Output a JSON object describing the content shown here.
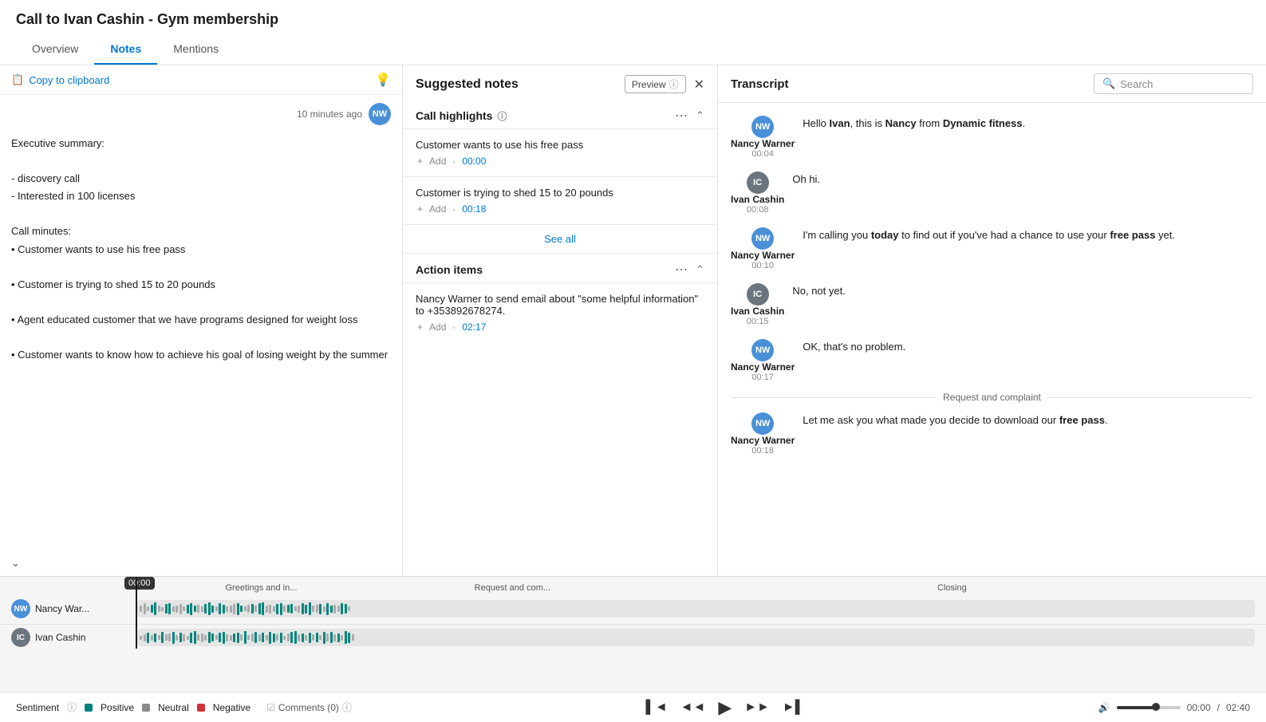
{
  "page": {
    "title": "Call to Ivan Cashin - Gym membership"
  },
  "tabs": [
    {
      "id": "overview",
      "label": "Overview",
      "active": false
    },
    {
      "id": "notes",
      "label": "Notes",
      "active": true
    },
    {
      "id": "mentions",
      "label": "Mentions",
      "active": false
    }
  ],
  "left_panel": {
    "copy_label": "Copy to clipboard",
    "timestamp": "10 minutes ago",
    "notes_content": [
      "Executive summary:",
      "",
      "- discovery call",
      "- Interested in 100 licenses",
      "",
      "Call minutes:",
      "• Customer wants to use his free pass",
      "",
      "• Customer is trying to shed 15 to 20 pounds",
      "",
      "• Agent educated customer that we have programs designed for weight loss",
      "",
      "• Customer wants to know how to achieve his goal of losing weight by the summer"
    ]
  },
  "suggested_notes": {
    "title": "Suggested notes",
    "preview_label": "Preview",
    "call_highlights": {
      "title": "Call highlights",
      "items": [
        {
          "text": "Customer wants to use his free pass",
          "timestamp": "00:00"
        },
        {
          "text": "Customer is trying to shed 15 to 20 pounds",
          "timestamp": "00:18"
        }
      ],
      "add_label": "+ Add",
      "see_all": "See all"
    },
    "action_items": {
      "title": "Action items",
      "items": [
        {
          "text": "Nancy Warner to send email about \"some helpful information\" to +353892678274.",
          "timestamp": "02:17"
        }
      ],
      "add_label": "+ Add"
    }
  },
  "transcript": {
    "title": "Transcript",
    "search_placeholder": "Search",
    "messages": [
      {
        "speaker": "Nancy Warner",
        "initials": "NW",
        "time": "00:04",
        "avatar_color": "#4a90d9",
        "text_parts": [
          {
            "text": "Hello ",
            "bold": false
          },
          {
            "text": "Ivan",
            "bold": true
          },
          {
            "text": ", this is ",
            "bold": false
          },
          {
            "text": "Nancy",
            "bold": true
          },
          {
            "text": " from ",
            "bold": false
          },
          {
            "text": "Dynamic fitness",
            "bold": true
          },
          {
            "text": ".",
            "bold": false
          }
        ]
      },
      {
        "speaker": "Ivan Cashin",
        "initials": "IC",
        "time": "00:08",
        "avatar_color": "#6c757d",
        "text_parts": [
          {
            "text": "Oh hi.",
            "bold": false
          }
        ]
      },
      {
        "speaker": "Nancy Warner",
        "initials": "NW",
        "time": "00:10",
        "avatar_color": "#4a90d9",
        "text_parts": [
          {
            "text": "I'm calling you ",
            "bold": false
          },
          {
            "text": "today",
            "bold": true
          },
          {
            "text": " to find out if you've had a chance to use your ",
            "bold": false
          },
          {
            "text": "free pass",
            "bold": true
          },
          {
            "text": " yet.",
            "bold": false
          }
        ]
      },
      {
        "speaker": "Ivan Cashin",
        "initials": "IC",
        "time": "00:15",
        "avatar_color": "#6c757d",
        "text_parts": [
          {
            "text": "No, not yet.",
            "bold": false
          }
        ]
      },
      {
        "speaker": "Nancy Warner",
        "initials": "NW",
        "time": "00:17",
        "avatar_color": "#4a90d9",
        "text_parts": [
          {
            "text": "OK, that's no problem.",
            "bold": false
          }
        ]
      },
      {
        "divider": "Request and complaint"
      },
      {
        "speaker": "Nancy Warner",
        "initials": "NW",
        "time": "00:18",
        "avatar_color": "#4a90d9",
        "text_parts": [
          {
            "text": "Let me ask you what made you decide to download our ",
            "bold": false
          },
          {
            "text": "free pass",
            "bold": true
          },
          {
            "text": ".",
            "bold": false
          }
        ]
      }
    ]
  },
  "timeline": {
    "current_time": "00:00",
    "segments": [
      {
        "label": "Greetings and in...",
        "type": "intro"
      },
      {
        "label": "Request and com...",
        "type": "request"
      },
      {
        "label": "Closing",
        "type": "closing"
      }
    ]
  },
  "bottom_bar": {
    "sentiment_label": "Sentiment",
    "positive_label": "Positive",
    "neutral_label": "Neutral",
    "negative_label": "Negative",
    "comments_label": "Comments (0)",
    "current_time": "00:00",
    "total_time": "02:40"
  }
}
